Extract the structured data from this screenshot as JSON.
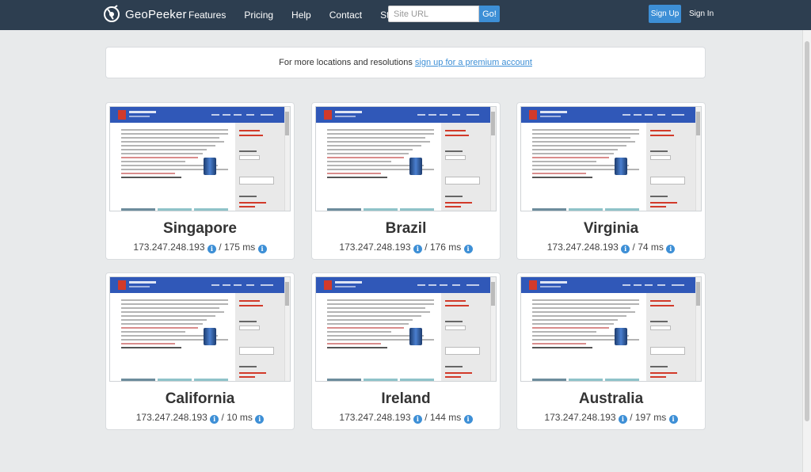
{
  "navbar": {
    "brand": "GeoPeeker",
    "links": [
      "Features",
      "Pricing",
      "Help",
      "Contact",
      "Status"
    ],
    "search_placeholder": "Site URL",
    "go_label": "Go!",
    "signup_label": "Sign Up",
    "signin_label": "Sign In"
  },
  "banner": {
    "text": "For more locations and resolutions ",
    "link": "sign up for a premium account"
  },
  "results": [
    {
      "city": "Singapore",
      "ip": "173.247.248.193",
      "latency": "175 ms"
    },
    {
      "city": "Brazil",
      "ip": "173.247.248.193",
      "latency": "176 ms"
    },
    {
      "city": "Virginia",
      "ip": "173.247.248.193",
      "latency": "74 ms"
    },
    {
      "city": "California",
      "ip": "173.247.248.193",
      "latency": "10 ms"
    },
    {
      "city": "Ireland",
      "ip": "173.247.248.193",
      "latency": "144 ms"
    },
    {
      "city": "Australia",
      "ip": "173.247.248.193",
      "latency": "197 ms"
    }
  ],
  "icons": {
    "brand": "globe-logo-icon",
    "info": "info-circle-icon"
  },
  "colors": {
    "navbar": "#2d3e50",
    "accent": "#3d8fd6",
    "background": "#e8eaeb"
  }
}
